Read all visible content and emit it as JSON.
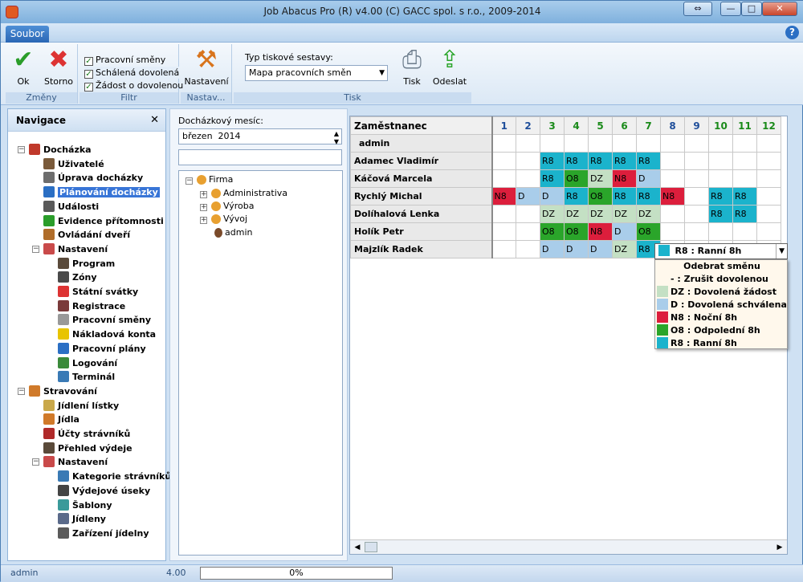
{
  "window": {
    "title": "Job Abacus Pro (R) v4.00 (C) GACC spol. s r.o., 2009-2014"
  },
  "menu": {
    "file_tab": "Soubor"
  },
  "ribbon": {
    "ok": "Ok",
    "storno": "Storno",
    "zmeny": "Změny",
    "filters": [
      "Pracovní směny",
      "Schálená dovolená",
      "Žádost o dovolenou"
    ],
    "filtr": "Filtr",
    "nastaveni": "Nastavení",
    "nastav_group": "Nastav...",
    "report_type_label": "Typ tiskové sestavy:",
    "report_type_value": "Mapa pracovních směn",
    "tisk": "Tisk",
    "odeslat": "Odeslat",
    "tisk_group": "Tisk"
  },
  "nav": {
    "title": "Navigace",
    "items": [
      {
        "label": "Docházka",
        "color": "#c0392b"
      },
      {
        "label": "Uživatelé",
        "color": "#7a5a3a"
      },
      {
        "label": "Úprava docházky",
        "color": "#6d6d6d"
      },
      {
        "label": "Plánování docházky",
        "color": "#2b6fc4"
      },
      {
        "label": "Události",
        "color": "#5a5a5a"
      },
      {
        "label": "Evidence přítomnosti",
        "color": "#2a9d2a"
      },
      {
        "label": "Ovládání dveří",
        "color": "#b06d2a"
      },
      {
        "label": "Nastavení",
        "color": "#c94a4a"
      },
      {
        "label": "Program",
        "color": "#5a4a3a"
      },
      {
        "label": "Zóny",
        "color": "#4a4a4a"
      },
      {
        "label": "Státní svátky",
        "color": "#d33"
      },
      {
        "label": "Registrace",
        "color": "#7a3a3a"
      },
      {
        "label": "Pracovní směny",
        "color": "#999"
      },
      {
        "label": "Nákladová konta",
        "color": "#e8c400"
      },
      {
        "label": "Pracovní plány",
        "color": "#2b6fc4"
      },
      {
        "label": "Logování",
        "color": "#3a8a3a"
      },
      {
        "label": "Terminál",
        "color": "#3a7ab5"
      },
      {
        "label": "Stravování",
        "color": "#d07a2a"
      },
      {
        "label": "Jídlení lístky",
        "color": "#c9a84a"
      },
      {
        "label": "Jídla",
        "color": "#d07a2a"
      },
      {
        "label": "Účty strávníků",
        "color": "#b02a2a"
      },
      {
        "label": "Přehled výdeje",
        "color": "#5a4a3a"
      },
      {
        "label": "Nastavení",
        "color": "#c94a4a"
      },
      {
        "label": "Kategorie strávníků",
        "color": "#3a7ab5"
      },
      {
        "label": "Výdejové úseky",
        "color": "#444"
      },
      {
        "label": "Šablony",
        "color": "#3a9a9a"
      },
      {
        "label": "Jídleny",
        "color": "#5a6a8a"
      },
      {
        "label": "Zařízení jídelny",
        "color": "#5a5a5a"
      }
    ]
  },
  "month": {
    "label": "Docházkový mesíc:",
    "month": "březen",
    "year": "2014"
  },
  "org": {
    "root": "Firma",
    "children": [
      "Administrativa",
      "Výroba",
      "Vývoj"
    ],
    "user": "admin"
  },
  "grid": {
    "header": "Zaměstnanec",
    "days": [
      "1",
      "2",
      "3",
      "4",
      "5",
      "6",
      "7",
      "8",
      "9",
      "10",
      "11",
      "12"
    ],
    "rows": [
      {
        "name": "admin",
        "cells": [
          "",
          "",
          "",
          "",
          "",
          "",
          "",
          "",
          "",
          "",
          "",
          ""
        ]
      },
      {
        "name": "Adamec Vladimír",
        "cells": [
          "",
          "",
          "R8",
          "R8",
          "R8",
          "R8",
          "R8",
          "",
          "",
          "",
          "",
          ""
        ]
      },
      {
        "name": "Káčová Marcela",
        "cells": [
          "",
          "",
          "R8",
          "O8",
          "DZ",
          "N8",
          "D",
          "",
          "",
          "",
          "",
          ""
        ]
      },
      {
        "name": "Rychlý Michal",
        "cells": [
          "N8",
          "D",
          "D",
          "R8",
          "O8",
          "R8",
          "R8",
          "N8",
          "",
          "R8",
          "R8",
          ""
        ]
      },
      {
        "name": "Dolíhalová Lenka",
        "cells": [
          "",
          "",
          "DZ",
          "DZ",
          "DZ",
          "DZ",
          "DZ",
          "",
          "",
          "R8",
          "R8",
          ""
        ]
      },
      {
        "name": "Holík Petr",
        "cells": [
          "",
          "",
          "O8",
          "O8",
          "N8",
          "D",
          "O8",
          "",
          "",
          "",
          "",
          ""
        ]
      },
      {
        "name": "Majzlík Radek",
        "cells": [
          "",
          "",
          "D",
          "D",
          "D",
          "DZ",
          "R8",
          "",
          "",
          "",
          "",
          ""
        ]
      }
    ],
    "shift_colors": {
      "R8": "#1bb3cc",
      "O8": "#2aa52a",
      "N8": "#dc1e3c",
      "DZ": "#c4e0c4",
      "D": "#a9cdea"
    }
  },
  "dropdown": {
    "selected": "R8 : Ranní 8h",
    "options": [
      {
        "label": "Odebrat směnu",
        "color": ""
      },
      {
        "label": "- : Zrušit dovolenou",
        "color": ""
      },
      {
        "label": "DZ : Dovolená žádost",
        "color": "#c4e0c4"
      },
      {
        "label": "D  : Dovolená schválena",
        "color": "#a9cdea"
      },
      {
        "label": "N8 : Noční 8h",
        "color": "#dc1e3c"
      },
      {
        "label": "O8 : Odpolední 8h",
        "color": "#2aa52a"
      },
      {
        "label": "R8 : Ranní 8h",
        "color": "#1bb3cc"
      }
    ]
  },
  "status": {
    "user": "admin",
    "version": "4.00",
    "progress": "0%"
  }
}
